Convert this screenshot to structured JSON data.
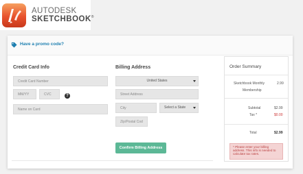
{
  "brand": {
    "line1": "AUTODESK",
    "line2": "SKETCHBOOK",
    "trademark": "®"
  },
  "promo": {
    "icon": "tag-icon",
    "text": "Have a promo code?"
  },
  "credit_card": {
    "title": "Credit Card Info",
    "card_number_placeholder": "Credit Card Number",
    "expiry_placeholder": "MM/YY",
    "cvc_placeholder": "CVC",
    "help_glyph": "?",
    "name_placeholder": "Name on Card"
  },
  "billing": {
    "title": "Billing Address",
    "country_selected": "United States",
    "street_placeholder": "Street Address",
    "city_placeholder": "City",
    "state_selected": "Select a State",
    "zip_placeholder": "Zip/Postal Code",
    "confirm_label": "Confirm Billing Address"
  },
  "summary": {
    "title": "Order Summary",
    "item_name": "Sketchbook Monthly",
    "item_name2": "Membership",
    "item_price": "2.99",
    "subtotal_label": "Subtotal",
    "subtotal_value": "$2.99",
    "tax_label": "Tax *",
    "tax_value": "$0.00",
    "total_label": "Total",
    "total_value": "$2.99",
    "notice": "* Please enter your billing address. This info is needed to calculate tax rates."
  },
  "colors": {
    "accent_green": "#5cb896",
    "link_blue": "#1e7fb0",
    "alert_red": "#cc3333",
    "brand_orange": "#e8522c"
  }
}
